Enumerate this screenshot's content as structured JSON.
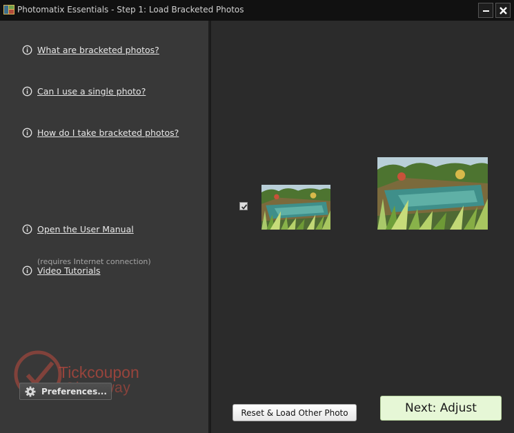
{
  "window": {
    "title": "Photomatix Essentials - Step 1: Load Bracketed Photos",
    "minimize_icon": "minimize-icon",
    "close_icon": "close-icon"
  },
  "help_links": [
    {
      "label": "What are bracketed photos?",
      "icon": "info-icon"
    },
    {
      "label": "Can I use a single photo?",
      "icon": "info-icon"
    },
    {
      "label": "How do I take bracketed photos?",
      "icon": "info-icon"
    },
    {
      "label": "Open the User Manual",
      "icon": "info-icon"
    },
    {
      "label": "Video Tutorials",
      "icon": "info-icon",
      "note": "(requires Internet connection)"
    }
  ],
  "watermark": {
    "line1": "Tickcoupon",
    "line2": "Giveaway"
  },
  "preferences": {
    "label": "Preferences...",
    "icon": "gear-icon"
  },
  "photos": [
    {
      "kind": "bracketed-photo-thumbnail",
      "checked": true
    },
    {
      "kind": "preview-image"
    }
  ],
  "actions": {
    "reset_label": "Reset & Load Other Photo",
    "next_label": "Next: Adjust"
  },
  "colors": {
    "left_panel_bg": "#383838",
    "right_panel_bg": "#2b2b2b",
    "next_button_bg": "#e6f7d6",
    "watermark": "#be4a3e"
  }
}
